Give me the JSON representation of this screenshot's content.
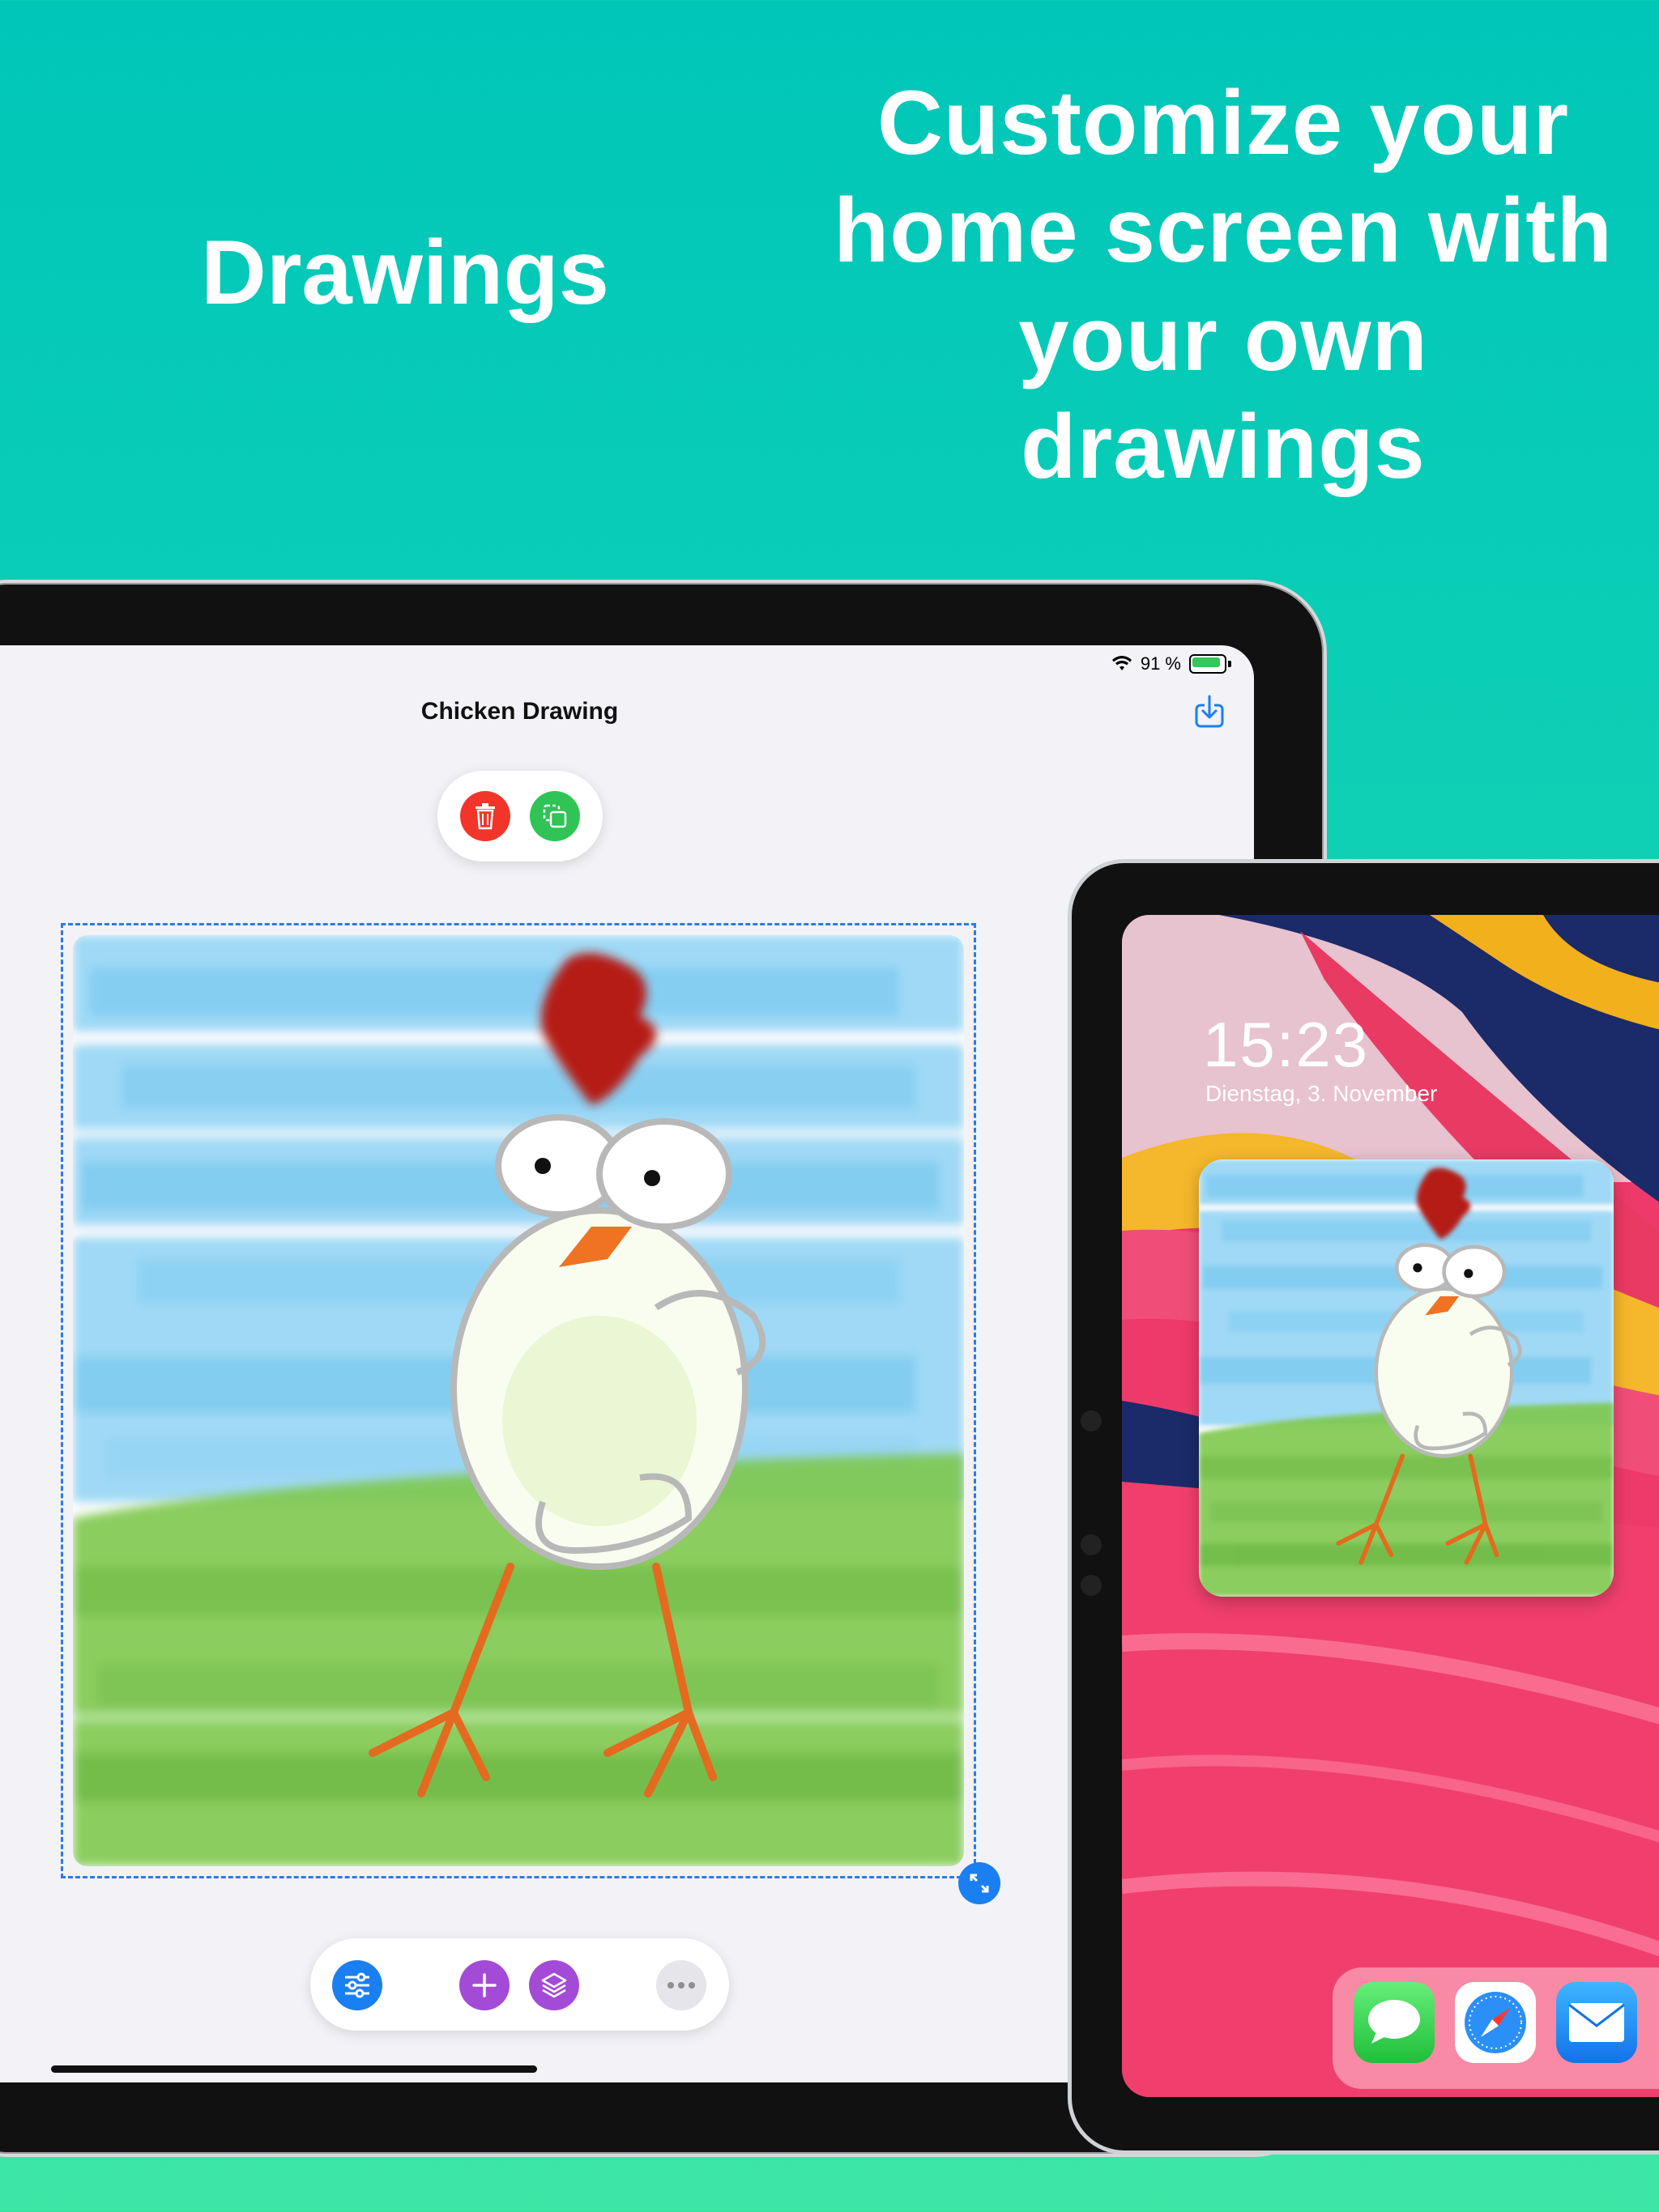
{
  "marketing": {
    "headline_left": "Drawings",
    "headline_right_lines": [
      "Customize your",
      "home screen with",
      "your own",
      "drawings"
    ]
  },
  "editor": {
    "status": {
      "battery_text": "91 %"
    },
    "title": "Chicken Drawing",
    "top_actions": [
      {
        "name": "delete",
        "color": "#f2352a"
      },
      {
        "name": "duplicate",
        "color": "#2fc455"
      }
    ],
    "bottom_toolbar": [
      {
        "name": "settings",
        "color": "#1a7ff0"
      },
      {
        "name": "add",
        "color": "#a34bd6"
      },
      {
        "name": "layers",
        "color": "#a34bd6"
      },
      {
        "name": "more",
        "color": "#e5e5ea"
      }
    ]
  },
  "lockscreen": {
    "time": "15:23",
    "date": "Dienstag, 3. November",
    "dock_apps": [
      "messages-icon",
      "safari-icon",
      "mail-icon"
    ]
  },
  "colors": {
    "bg_top": "#00c6b9",
    "bg_bottom": "#3ee6a6",
    "accent_blue": "#1a7ff0"
  }
}
